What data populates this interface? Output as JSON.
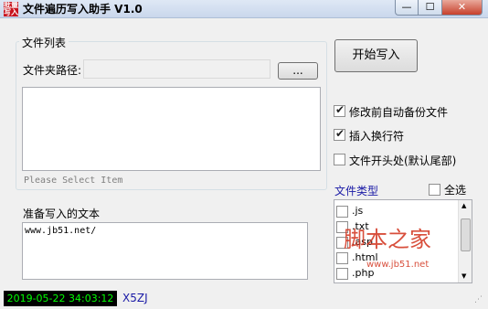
{
  "window": {
    "title": "文件遍历写入助手 V1.0",
    "icon_text": "批量\n写入",
    "min_glyph": "—",
    "max_glyph": "☐",
    "close_glyph": "✕"
  },
  "file_list": {
    "group_label": "文件列表",
    "folder_path_label": "文件夹路径:",
    "folder_path_value": "",
    "browse_label": "...",
    "placeholder_hint": "Please Select Item"
  },
  "text_section": {
    "label": "准备写入的文本",
    "value": "www.jb51.net/"
  },
  "actions": {
    "start_label": "开始写入"
  },
  "options": [
    {
      "label": "修改前自动备份文件",
      "checked": true
    },
    {
      "label": "插入换行符",
      "checked": true
    },
    {
      "label": "文件开头处(默认尾部)",
      "checked": false
    }
  ],
  "file_types": {
    "label": "文件类型",
    "select_all_label": "全选",
    "items": [
      ".js",
      ".txt",
      ".asp",
      ".html",
      ".php"
    ],
    "watermark_text": "脚本之家",
    "watermark_url": "www.jb51.net"
  },
  "status": {
    "datetime": "2019-05-22 34:03:12",
    "code": "X5ZJ"
  },
  "colors": {
    "accent_blue": "#1a1aa6",
    "clock_green": "#00ff00",
    "watermark_red": "#d43c28"
  }
}
